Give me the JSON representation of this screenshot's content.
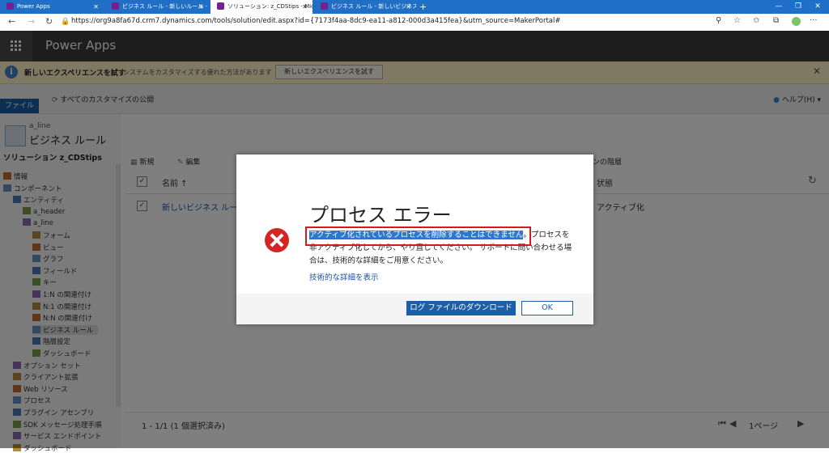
{
  "browser": {
    "tabs": [
      {
        "label": "Power Apps",
        "active": false
      },
      {
        "label": "ビジネス ルール - 新しいルール - Micr",
        "active": false
      },
      {
        "label": "ソリューション: z_CDStips - Microso",
        "active": true
      },
      {
        "label": "ビジネス ルール - 新しいビジネス ル",
        "active": false
      }
    ],
    "new_tab": "+",
    "url": "https://org9a8fa67d.crm7.dynamics.com/tools/solution/edit.aspx?id={7173f4aa-8dc9-ea11-a812-000d3a415fea}&utm_source=MakerPortal#",
    "more": "···"
  },
  "app": {
    "title": "Power Apps"
  },
  "notice": {
    "title": "新しいエクスペリエンスを試す",
    "text": "システムをカスタマイズする優れた方法があります",
    "button": "新しいエクスペリエンスを試す",
    "close": "✕"
  },
  "ribbon": {
    "file": "ファイル",
    "publish": "すべてのカスタマイズの公開",
    "help": "ヘルプ(H)"
  },
  "page": {
    "entity": "a_line",
    "title": "ビジネス ルール",
    "solution": "ソリューション z_CDStips"
  },
  "tree": [
    {
      "label": "情報",
      "indent": 0
    },
    {
      "label": "コンポーネント",
      "indent": 0
    },
    {
      "label": "エンティティ",
      "indent": 1
    },
    {
      "label": "a_header",
      "indent": 2
    },
    {
      "label": "a_line",
      "indent": 2
    },
    {
      "label": "フォーム",
      "indent": 3
    },
    {
      "label": "ビュー",
      "indent": 3
    },
    {
      "label": "グラフ",
      "indent": 3
    },
    {
      "label": "フィールド",
      "indent": 3
    },
    {
      "label": "キー",
      "indent": 3
    },
    {
      "label": "1:N の関連付け",
      "indent": 3
    },
    {
      "label": "N:1 の関連付け",
      "indent": 3
    },
    {
      "label": "N:N の関連付け",
      "indent": 3
    },
    {
      "label": "ビジネス ルール",
      "indent": 3,
      "selected": true
    },
    {
      "label": "階層設定",
      "indent": 3
    },
    {
      "label": "ダッシュボード",
      "indent": 3
    },
    {
      "label": "オプション セット",
      "indent": 1
    },
    {
      "label": "クライアント拡張",
      "indent": 1
    },
    {
      "label": "Web リソース",
      "indent": 1
    },
    {
      "label": "プロセス",
      "indent": 1
    },
    {
      "label": "プラグイン アセンブリ",
      "indent": 1
    },
    {
      "label": "SDK メッセージ処理手順",
      "indent": 1
    },
    {
      "label": "サービス エンドポイント",
      "indent": 1
    },
    {
      "label": "ダッシュボード",
      "indent": 1
    }
  ],
  "grid": {
    "toolbar": {
      "new": "新規",
      "edit": "編集",
      "hierarchy": "ョンの階層"
    },
    "col_name": "名前 ↑",
    "col_status": "状態",
    "row": {
      "name": "新しいビジネス ルール",
      "status": "アクティブ化"
    },
    "footer_count": "1 - 1/1 (1 個選択済み)",
    "footer_page": "1ページ"
  },
  "dialog": {
    "title": "プロセス エラー",
    "message_highlight": "アクティブ化されているプロセスを削除することはできません",
    "message_rest": "。プロセスを非アクティブ化してから、やり直してください。 サポートに問い合わせる場合は、技術的な詳細をご用意ください。",
    "details_link": "技術的な詳細を表示",
    "download_button": "ログ ファイルのダウンロード",
    "ok_button": "OK"
  },
  "icons": {
    "error": "error-x-icon",
    "info": "info-icon",
    "waffle": "app-launcher-icon"
  }
}
